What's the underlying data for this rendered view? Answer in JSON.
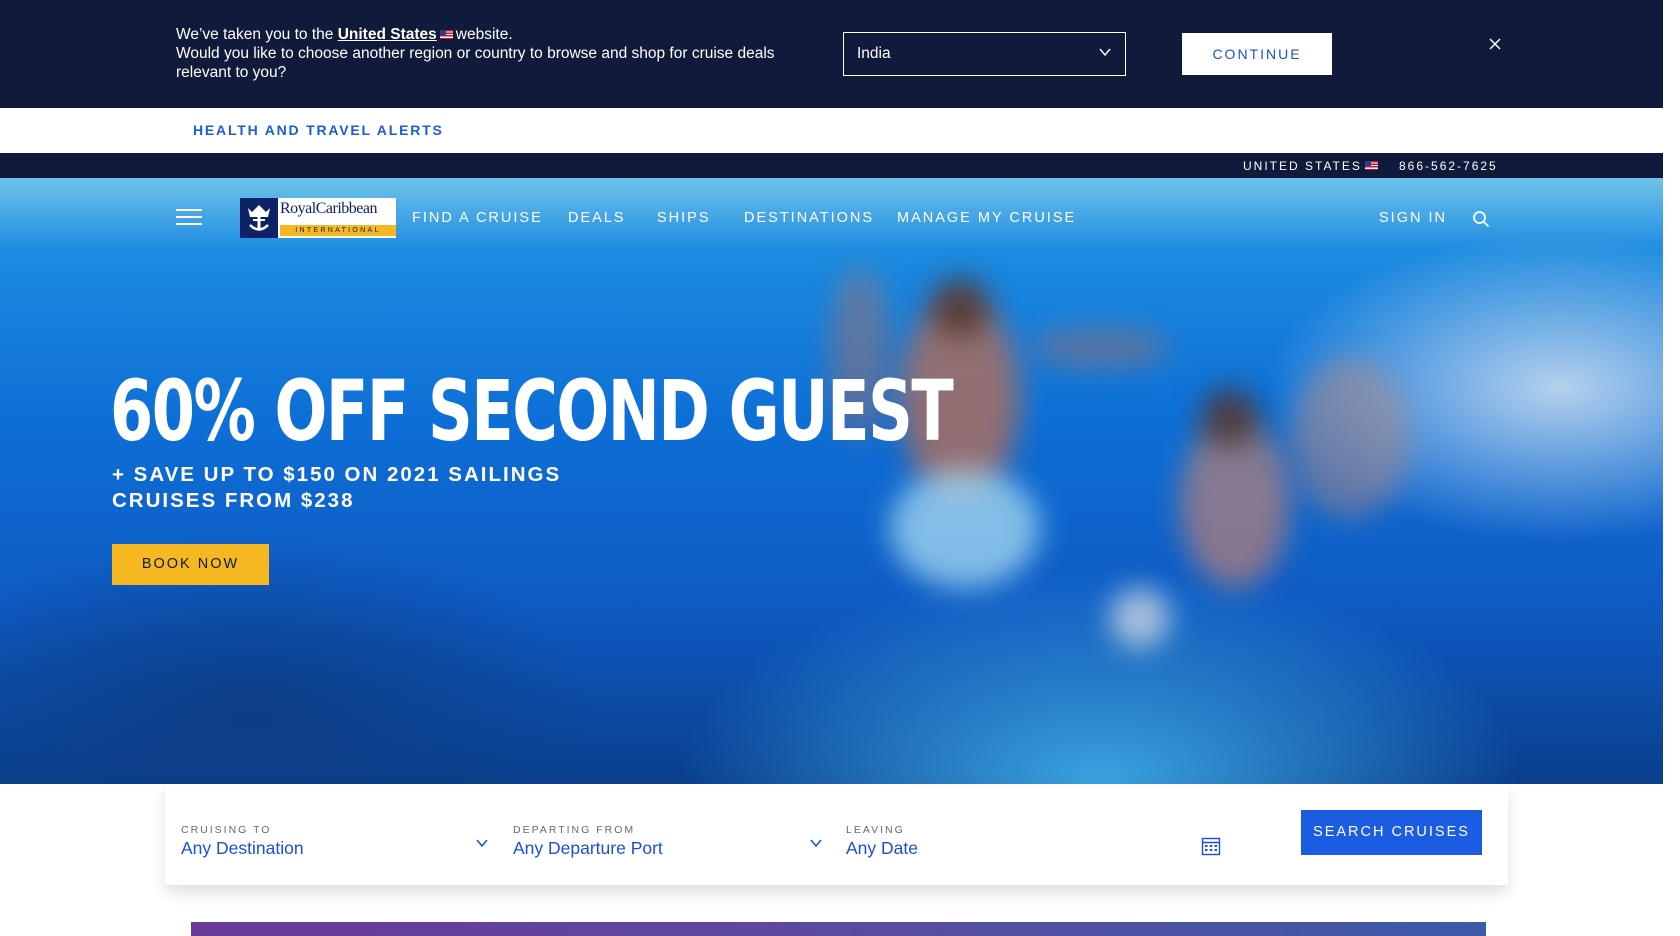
{
  "region_banner": {
    "line1_prefix": "We’ve taken you to the",
    "line1_link": "United States",
    "line1_suffix": "website.",
    "line2": "Would you like to choose another region or country to browse and shop for cruise deals relevant to you?",
    "select_value": "India",
    "continue_label": "CONTINUE",
    "close_icon": "close-icon"
  },
  "alerts": {
    "label": "HEALTH AND TRAVEL ALERTS"
  },
  "utility": {
    "country": "UNITED STATES",
    "phone": "866-562-7625"
  },
  "header": {
    "logo_text": "RoyalCaribbean",
    "logo_subtext": "INTERNATIONAL",
    "nav": [
      "FIND A CRUISE",
      "DEALS",
      "SHIPS",
      "DESTINATIONS",
      "MANAGE MY CRUISE"
    ],
    "sign_in": "SIGN IN",
    "icons": [
      "menu-icon",
      "search-icon"
    ]
  },
  "hero": {
    "title": "60% OFF SECOND GUEST",
    "subtitle_line1": "+ SAVE UP TO $150 ON 2021 SAILINGS",
    "subtitle_line2": "CRUISES FROM $238",
    "cta": "BOOK NOW"
  },
  "search": {
    "fields": [
      {
        "label": "CRUISING TO",
        "value": "Any Destination"
      },
      {
        "label": "DEPARTING FROM",
        "value": "Any Departure Port"
      },
      {
        "label": "LEAVING",
        "value": "Any Date"
      }
    ],
    "button": "SEARCH CRUISES"
  },
  "colors": {
    "navy": "#101b3b",
    "accent_blue": "#1c5ce0",
    "cta_yellow": "#f5b820"
  }
}
